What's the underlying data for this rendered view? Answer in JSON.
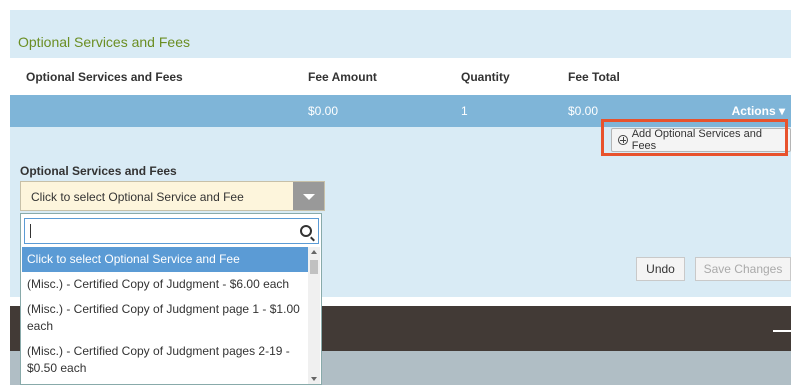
{
  "panel": {
    "title": "Optional Services and Fees"
  },
  "table": {
    "headers": [
      "Optional Services and Fees",
      "Fee Amount",
      "Quantity",
      "Fee Total"
    ],
    "row": {
      "name": "",
      "fee_amount": "$0.00",
      "quantity": "1",
      "fee_total": "$0.00",
      "actions_label": "Actions ▾"
    }
  },
  "add_button": {
    "label": "Add Optional Services and Fees",
    "icon": "plus-circle-icon"
  },
  "field": {
    "label": "Optional Services and Fees",
    "selected_value": "Click to select Optional Service and Fee"
  },
  "dropdown": {
    "search_value": "",
    "options": [
      "Click to select Optional Service and Fee",
      "(Misc.) - Certified Copy of Judgment - $6.00 each",
      "(Misc.) - Certified Copy of Judgment page 1 - $1.00 each",
      "(Misc.) - Certified Copy of Judgment pages 2-19 - $0.50 each"
    ]
  },
  "buttons": {
    "undo": "Undo",
    "save": "Save Changes"
  },
  "colors": {
    "panel_bg": "#d9ebf5",
    "row_bg": "#7fb5d8",
    "highlight": "#e8522c",
    "title": "#6b8e23",
    "selected_option": "#5b9bd5"
  }
}
